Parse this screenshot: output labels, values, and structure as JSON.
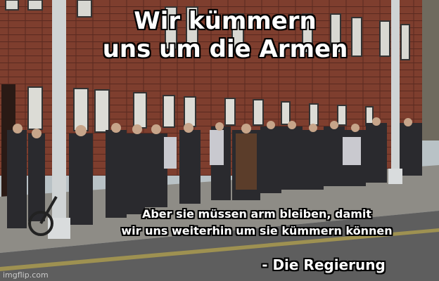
{
  "meme": {
    "top_caption": [
      "Wir kümmern",
      "uns um die Armen"
    ],
    "bottom_caption": [
      "Aber sie müssen arm bleiben, damit",
      "wir uns weiterhin um sie kümmern können"
    ],
    "attribution": "- Die Regierung",
    "watermark": "imgflip.com"
  }
}
